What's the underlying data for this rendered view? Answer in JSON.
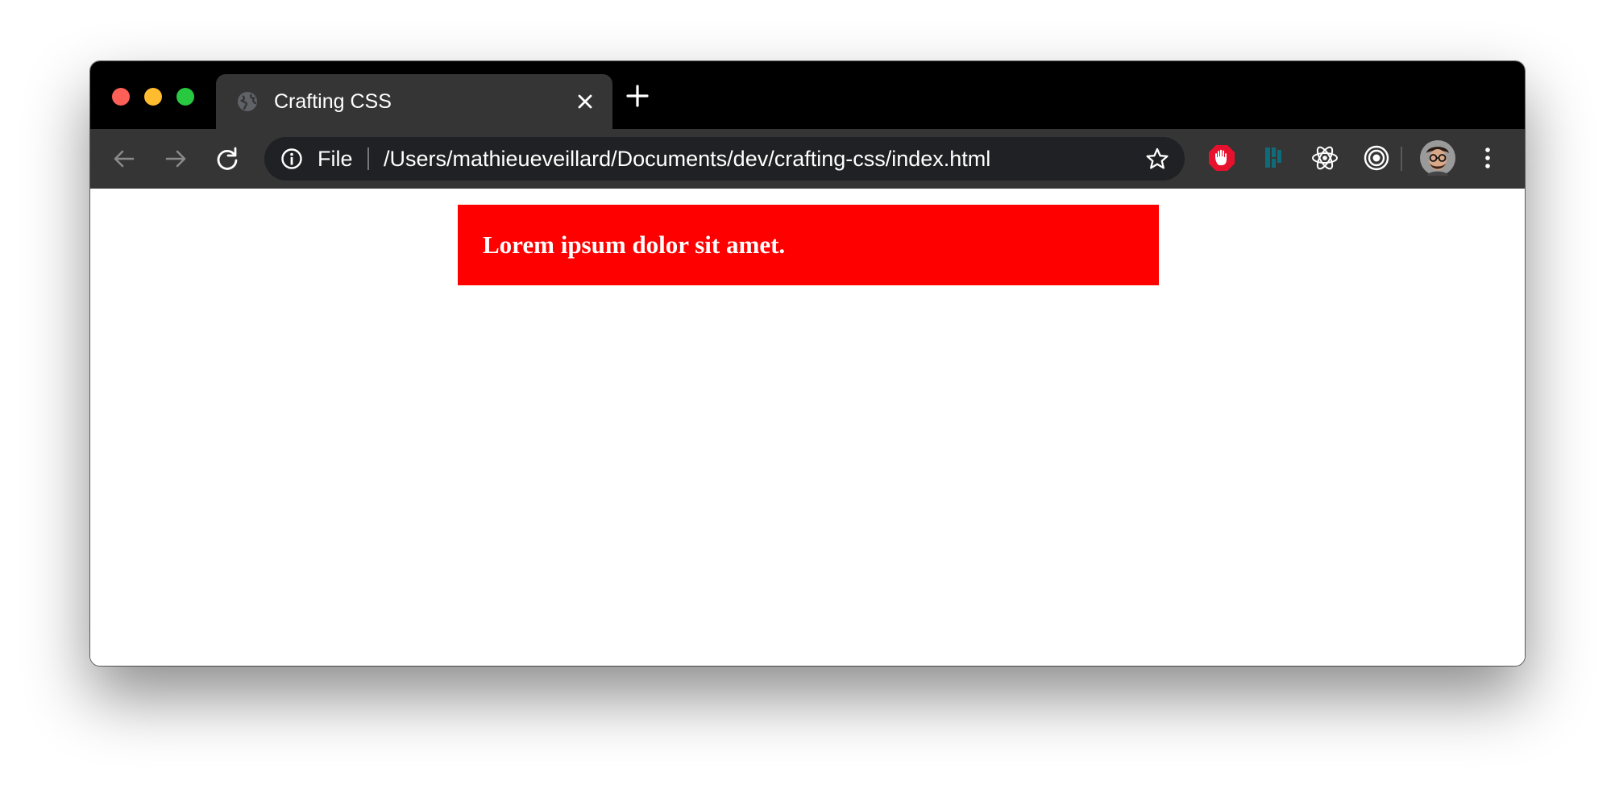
{
  "browser": {
    "tab": {
      "title": "Crafting CSS",
      "favicon": "globe-icon"
    },
    "toolbar": {
      "back": "arrow-left-icon",
      "forward": "arrow-right-icon",
      "reload": "reload-icon"
    },
    "omnibox": {
      "scheme_label": "File",
      "url": "/Users/mathieueveillard/Documents/dev/crafting-css/index.html",
      "info": "info-icon",
      "bookmark": "star-icon"
    },
    "extensions": [
      {
        "name": "adblock-icon",
        "color": "#e8112d"
      },
      {
        "name": "dashlane-icon",
        "color": "#0e6c7a"
      },
      {
        "name": "react-devtools-icon",
        "color": "#ffffff"
      },
      {
        "name": "target-icon",
        "color": "#ffffff"
      }
    ],
    "profile": "avatar",
    "menu": "more-vertical-icon"
  },
  "page": {
    "banner_text": "Lorem ipsum dolor sit amet.",
    "banner_color": "#ff0000"
  }
}
